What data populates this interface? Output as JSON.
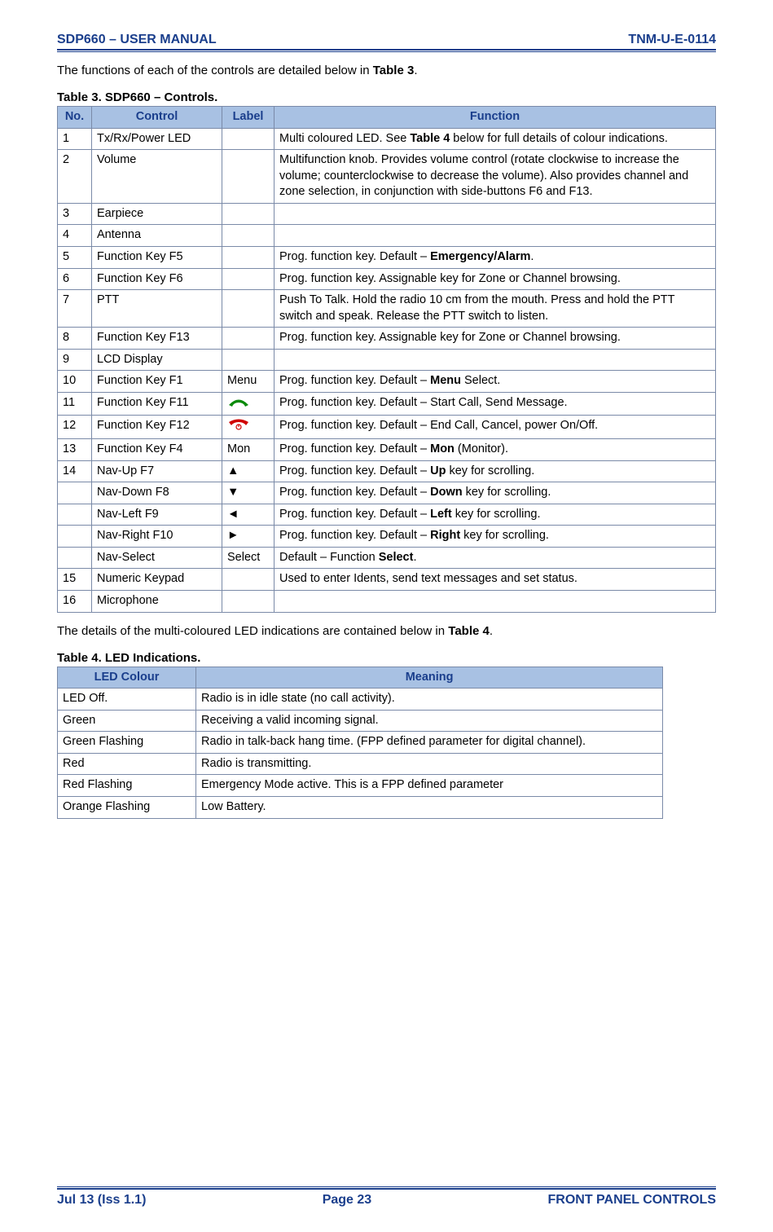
{
  "header": {
    "left": "SDP660 – USER MANUAL",
    "right": "TNM-U-E-0114"
  },
  "intro1": "The functions of each of the controls are detailed below in ",
  "intro1_bold": "Table 3",
  "intro1_end": ".",
  "table3_caption": "Table 3.  SDP660 – Controls.",
  "table3_headers": {
    "no": "No.",
    "control": "Control",
    "label": "Label",
    "function": "Function"
  },
  "table3_rows": [
    {
      "no": "1",
      "control": "Tx/Rx/Power LED",
      "label": "",
      "fn_pre": "Multi coloured LED.  See ",
      "fn_bold": "Table 4",
      "fn_post": " below for full details of colour indications."
    },
    {
      "no": "2",
      "control": "Volume",
      "label": "",
      "fn": "Multifunction knob.  Provides volume control (rotate clockwise to increase the volume; counterclockwise to decrease the volume).  Also provides channel and zone selection, in conjunction with side-buttons F6 and F13."
    },
    {
      "no": "3",
      "control": "Earpiece",
      "label": "",
      "fn": ""
    },
    {
      "no": "4",
      "control": "Antenna",
      "label": "",
      "fn": ""
    },
    {
      "no": "5",
      "control": "Function Key F5",
      "label": "",
      "fn_pre": "Prog. function key.  Default – ",
      "fn_bold": "Emergency/Alarm",
      "fn_post": "."
    },
    {
      "no": "6",
      "control": "Function Key F6",
      "label": "",
      "fn": "Prog. function key.   Assignable key for Zone or Channel browsing."
    },
    {
      "no": "7",
      "control": "PTT",
      "label": "",
      "fn": "Push To Talk.  Hold the radio 10 cm from the mouth.  Press and hold the PTT switch and speak.  Release the PTT switch to listen."
    },
    {
      "no": "8",
      "control": "Function Key F13",
      "label": "",
      "fn": "Prog. function key.   Assignable key for Zone or Channel browsing."
    },
    {
      "no": "9",
      "control": "LCD Display",
      "label": "",
      "fn": ""
    },
    {
      "no": "10",
      "control": "Function Key F1",
      "label": "Menu",
      "fn_pre": "Prog. function key.  Default – ",
      "fn_bold": "Menu",
      "fn_post": " Select."
    },
    {
      "no": "11",
      "control": "Function Key F11",
      "label_icon": "green-phone",
      "fn": "Prog. function key.  Default – Start Call, Send Message."
    },
    {
      "no": "12",
      "control": "Function Key F12",
      "label_icon": "red-phone",
      "fn": "Prog. function key.  Default – End Call, Cancel, power On/Off."
    },
    {
      "no": "13",
      "control": "Function Key F4",
      "label": "Mon",
      "fn_pre": "Prog. function key.  Default – ",
      "fn_bold": "Mon",
      "fn_post": " (Monitor)."
    },
    {
      "no": "14",
      "control": "Nav-Up F7",
      "label": "▲",
      "fn_pre": "Prog. function key.  Default – ",
      "fn_bold": "Up",
      "fn_post": " key for scrolling."
    },
    {
      "no": "",
      "control": "Nav-Down F8",
      "label": "▼",
      "fn_pre": "Prog. function key.  Default – ",
      "fn_bold": "Down",
      "fn_post": " key for scrolling."
    },
    {
      "no": "",
      "control": "Nav-Left F9",
      "label": "◄",
      "fn_pre": "Prog. function key.  Default – ",
      "fn_bold": "Left",
      "fn_post": " key for scrolling."
    },
    {
      "no": "",
      "control": "Nav-Right F10",
      "label": "►",
      "fn_pre": "Prog. function key.  Default – ",
      "fn_bold": "Right",
      "fn_post": " key for scrolling."
    },
    {
      "no": "",
      "control": "Nav-Select",
      "label": "Select",
      "fn_pre": "Default – Function ",
      "fn_bold": "Select",
      "fn_post": "."
    },
    {
      "no": "15",
      "control": "Numeric Keypad",
      "label": "",
      "fn": "Used to enter Idents, send text messages and set status."
    },
    {
      "no": "16",
      "control": "Microphone",
      "label": "",
      "fn": ""
    }
  ],
  "intro2": "The details of the multi-coloured LED indications are contained below in ",
  "intro2_bold": "Table 4",
  "intro2_end": ".",
  "table4_caption": "Table 4.  LED Indications.",
  "table4_headers": {
    "led": "LED Colour",
    "meaning": "Meaning"
  },
  "table4_rows": [
    {
      "led": "LED Off.",
      "meaning": "Radio is in idle state (no call activity)."
    },
    {
      "led": "Green",
      "meaning": "Receiving a valid incoming signal."
    },
    {
      "led": "Green Flashing",
      "meaning": "Radio in talk-back hang time.  (FPP defined parameter for digital channel)."
    },
    {
      "led": "Red",
      "meaning": "Radio is transmitting."
    },
    {
      "led": "Red Flashing",
      "meaning": "Emergency Mode active.  This is a FPP defined parameter"
    },
    {
      "led": "Orange Flashing",
      "meaning": "Low Battery."
    }
  ],
  "footer": {
    "left": "Jul 13 (Iss 1.1)",
    "center": "Page 23",
    "right": "FRONT PANEL CONTROLS"
  },
  "icons": {
    "green_phone_aria": "call-start-icon",
    "red_phone_aria": "call-end-icon"
  }
}
